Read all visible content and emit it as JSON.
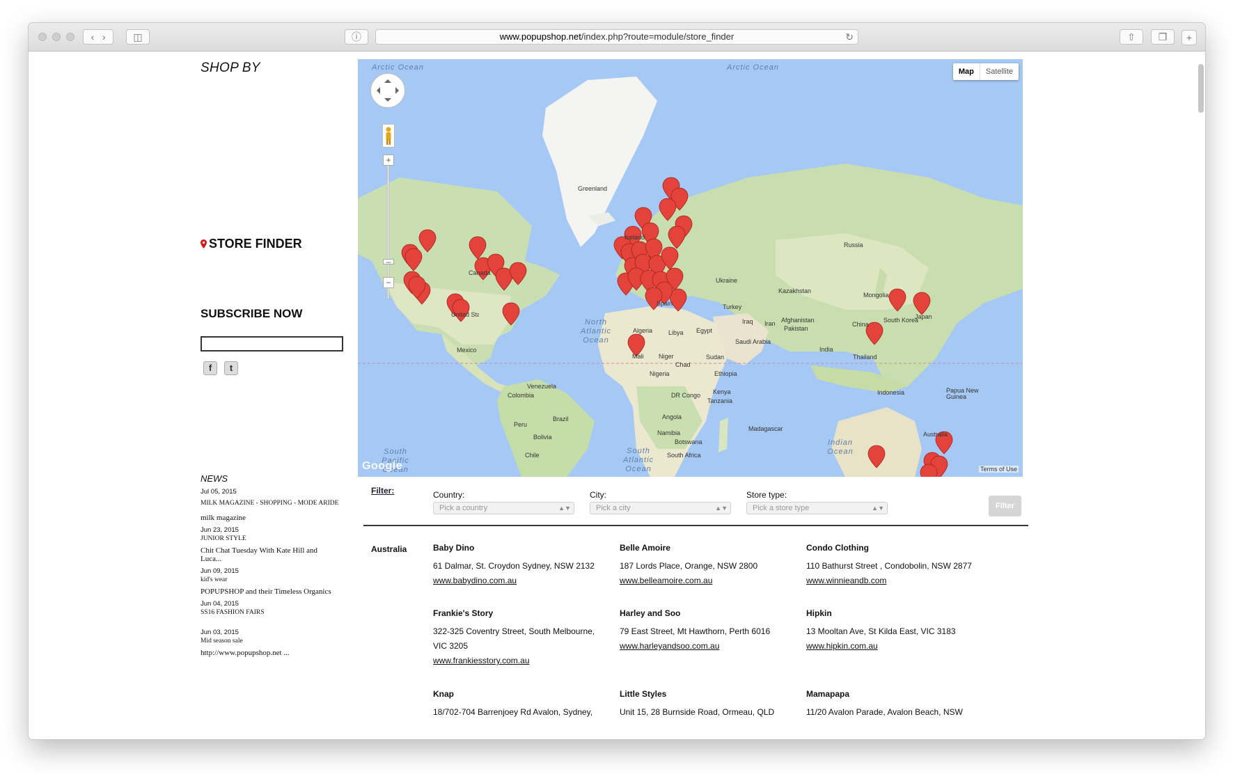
{
  "browser": {
    "url_host": "www.popupshop.net",
    "url_path": "/index.php?route=module/store_finder"
  },
  "sidebar": {
    "shop_by": "SHOP BY",
    "store_finder": "STORE FINDER",
    "subscribe": "SUBSCRIBE NOW",
    "social": [
      "f",
      "t"
    ]
  },
  "news": {
    "title": "NEWS",
    "items": [
      {
        "date": "Jul 05, 2015",
        "category": "MILK MAGAZINE - SHOPPING - MODE ARIDE",
        "headline": "milk magazine"
      },
      {
        "date": "Jun 23, 2015",
        "category": "JUNIOR STYLE",
        "headline": "Chit Chat Tuesday With Kate Hill and Luca..."
      },
      {
        "date": "Jun 09, 2015",
        "category": "kid's wear",
        "headline": "POPUPSHOP and their Timeless Organics"
      },
      {
        "date": "Jun 04, 2015",
        "category": "SS16 FASHION FAIRS",
        "headline": ""
      },
      {
        "date": "Jun 03, 2015",
        "category": "Mid season sale",
        "headline": "http://www.popupshop.net ..."
      }
    ]
  },
  "map": {
    "type_buttons": [
      "Map",
      "Satellite"
    ],
    "terms": "Terms of Use",
    "logo": "Google",
    "labels": [
      {
        "text": "Greenland"
      },
      {
        "text": "Iceland"
      },
      {
        "text": "Canada"
      },
      {
        "text": "Russia"
      },
      {
        "text": "Kazakhstan"
      },
      {
        "text": "Mongolia"
      },
      {
        "text": "China"
      },
      {
        "text": "South Korea"
      },
      {
        "text": "Japan"
      },
      {
        "text": "India"
      },
      {
        "text": "Thailand"
      },
      {
        "text": "Indonesia"
      },
      {
        "text": "Papua New Guinea"
      },
      {
        "text": "Australia"
      },
      {
        "text": "Afghanistan"
      },
      {
        "text": "Pakistan"
      },
      {
        "text": "Iran"
      },
      {
        "text": "Iraq"
      },
      {
        "text": "Saudi Arabia"
      },
      {
        "text": "Turkey"
      },
      {
        "text": "Ukraine"
      },
      {
        "text": "Spain"
      },
      {
        "text": "Algeria"
      },
      {
        "text": "Libya"
      },
      {
        "text": "Egypt"
      },
      {
        "text": "Mali"
      },
      {
        "text": "Niger"
      },
      {
        "text": "Chad"
      },
      {
        "text": "Sudan"
      },
      {
        "text": "Nigeria"
      },
      {
        "text": "Ethiopia"
      },
      {
        "text": "Kenya"
      },
      {
        "text": "Tanzania"
      },
      {
        "text": "DR Congo"
      },
      {
        "text": "Angola"
      },
      {
        "text": "Namibia"
      },
      {
        "text": "Botswana"
      },
      {
        "text": "Madagascar"
      },
      {
        "text": "South Africa"
      },
      {
        "text": "Mexico"
      },
      {
        "text": "United States"
      },
      {
        "text": "Venezuela"
      },
      {
        "text": "Colombia"
      },
      {
        "text": "Peru"
      },
      {
        "text": "Brazil"
      },
      {
        "text": "Bolivia"
      },
      {
        "text": "Chile"
      }
    ],
    "oceans": [
      "Arctic Ocean",
      "Arctic Ocean",
      "North Atlantic Ocean",
      "South Pacific Ocean",
      "South Atlantic Ocean",
      "Indian Ocean"
    ]
  },
  "filter": {
    "label": "Filter:",
    "country_label": "Country:",
    "country_placeholder": "Pick a country",
    "city_label": "City:",
    "city_placeholder": "Pick a city",
    "type_label": "Store type:",
    "type_placeholder": "Pick a store type",
    "button": "Filter"
  },
  "stores": {
    "country": "Australia",
    "list": [
      {
        "name": "Baby Dino",
        "address": "61 Dalmar, St. Croydon Sydney, NSW 2132",
        "url": "www.babydino.com.au"
      },
      {
        "name": "Belle Amoire",
        "address": "187 Lords Place, Orange, NSW 2800",
        "url": "www.belleamoire.com.au"
      },
      {
        "name": "Condo Clothing",
        "address": "110 Bathurst Street , Condobolin, NSW 2877",
        "url": "www.winnieandb.com"
      },
      {
        "name": "Frankie's Story",
        "address": "322-325 Coventry Street, South Melbourne, VIC 3205",
        "url": "www.frankiesstory.com.au"
      },
      {
        "name": "Harley and Soo",
        "address": "79 East Street, Mt Hawthorn, Perth 6016",
        "url": "www.harleyandsoo.com.au"
      },
      {
        "name": "Hipkin",
        "address": "13 Mooltan Ave, St Kilda East, VIC 3183",
        "url": "www.hipkin.com.au"
      },
      {
        "name": "Knap",
        "address": "18/702-704 Barrenjoey Rd Avalon, Sydney,",
        "url": ""
      },
      {
        "name": "Little Styles",
        "address": "Unit 15, 28 Burnside Road, Ormeau, QLD",
        "url": ""
      },
      {
        "name": "Mamapapa",
        "address": "11/20 Avalon Parade, Avalon Beach, NSW",
        "url": ""
      }
    ]
  }
}
